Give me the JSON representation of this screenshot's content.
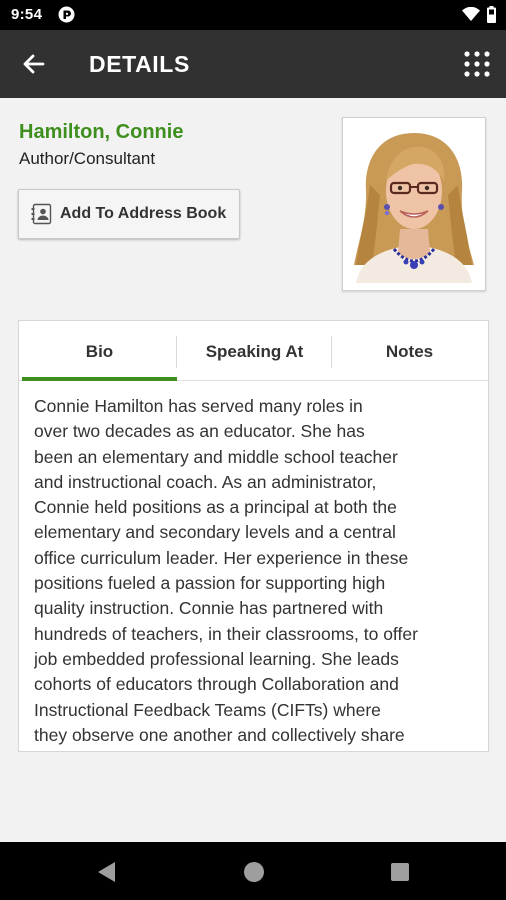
{
  "status_bar": {
    "time": "9:54",
    "app_icon": "pocket-app-icon",
    "wifi_icon": "wifi-icon",
    "battery_icon": "battery-icon"
  },
  "app_bar": {
    "title": "DETAILS",
    "back_icon": "arrow-back-icon",
    "menu_icon": "grid-menu-icon",
    "background": "#313131"
  },
  "profile": {
    "name": "Hamilton, Connie",
    "role": "Author/Consultant",
    "address_button_label": "Add To Address Book",
    "name_color": "#3f8f1e"
  },
  "tabs": [
    {
      "label": "Bio",
      "selected": true
    },
    {
      "label": "Speaking At",
      "selected": false
    },
    {
      "label": "Notes",
      "selected": false
    }
  ],
  "bio": {
    "lines": [
      "Connie Hamilton has served many roles in",
      "over two decades as an educator. She has",
      "been an elementary and middle school teacher",
      "and instructional coach. As an administrator,",
      "Connie held positions as a principal at both the",
      "elementary and secondary levels and a central",
      "office curriculum leader. Her experience in these",
      "positions fueled a passion for supporting high",
      "quality instruction. Connie has partnered with",
      "hundreds of teachers, in their classrooms, to offer",
      "job embedded professional learning. She leads",
      "cohorts of educators through Collaboration and",
      "Instructional Feedback Teams (CIFTs) where",
      "they observe one another and collectively share"
    ]
  },
  "nav_bar": {
    "back_icon": "nav-back-triangle-icon",
    "home_icon": "nav-home-circle-icon",
    "recents_icon": "nav-recents-square-icon"
  },
  "colors": {
    "accent": "#3f8f1e",
    "app_bar": "#313131",
    "background": "#f2f2f2"
  }
}
